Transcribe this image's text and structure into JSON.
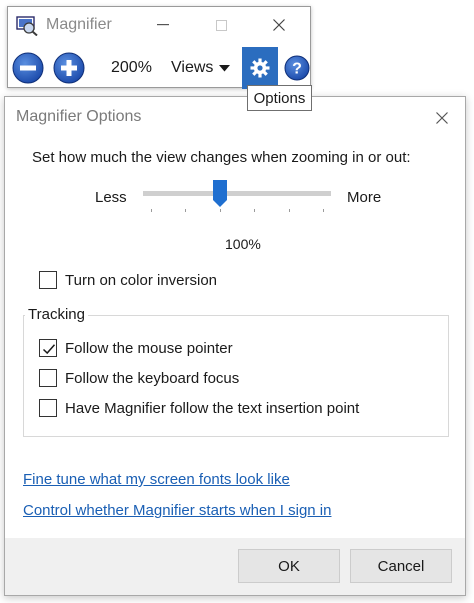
{
  "magnifier": {
    "title": "Magnifier",
    "zoom_level": "200%",
    "views_label": "Views",
    "icons": [
      "magnifier-app-icon",
      "minimize-icon",
      "maximize-icon",
      "close-icon",
      "zoom-out-icon",
      "zoom-in-icon",
      "chevron-down-icon",
      "gear-icon",
      "help-icon"
    ]
  },
  "tooltip": {
    "text": "Options"
  },
  "dialog": {
    "title": "Magnifier Options",
    "zoom_prompt": "Set how much the view changes when zooming in or out:",
    "slider": {
      "min_label": "Less",
      "max_label": "More",
      "value_text": "100%",
      "position_fraction": 0.41,
      "tick_count": 6
    },
    "color_inversion": {
      "label": "Turn on color inversion",
      "checked": false
    },
    "tracking": {
      "label": "Tracking",
      "options": [
        {
          "label": "Follow the mouse pointer",
          "checked": true
        },
        {
          "label": "Follow the keyboard focus",
          "checked": false
        },
        {
          "label": "Have Magnifier follow the text insertion point",
          "checked": false
        }
      ]
    },
    "links": {
      "fonts": "Fine tune what my screen fonts look like",
      "startup": "Control whether Magnifier starts when I sign in"
    },
    "buttons": {
      "ok": "OK",
      "cancel": "Cancel"
    }
  },
  "colors": {
    "accent_blue": "#2b6dbf",
    "link_blue": "#1a5fb4",
    "footer_gray": "#f0f0f0"
  }
}
